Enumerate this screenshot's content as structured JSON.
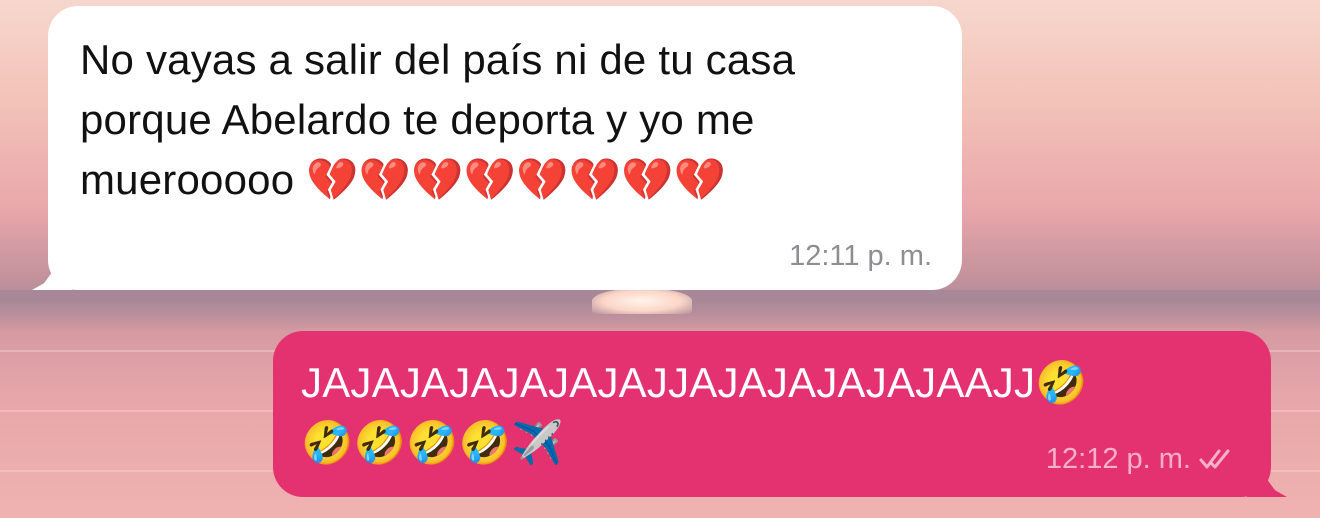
{
  "chat": {
    "received_message": {
      "lines": [
        "No vayas a salir del país ni de tu casa",
        "porque Abelardo te deporta y yo me",
        "muerooooo 💔💔💔💔💔💔💔💔"
      ],
      "time": "12:11 p. m."
    },
    "sent_message": {
      "lines": [
        "JAJAJAJAJAJAJAJJAJAJAJAJAJAAJJ🤣",
        "🤣🤣🤣🤣✈️"
      ],
      "time": "12:12 p. m.",
      "status_icon": "double-check-icon"
    }
  },
  "colors": {
    "incoming_bubble": "#ffffff",
    "outgoing_bubble": "#e43271"
  }
}
